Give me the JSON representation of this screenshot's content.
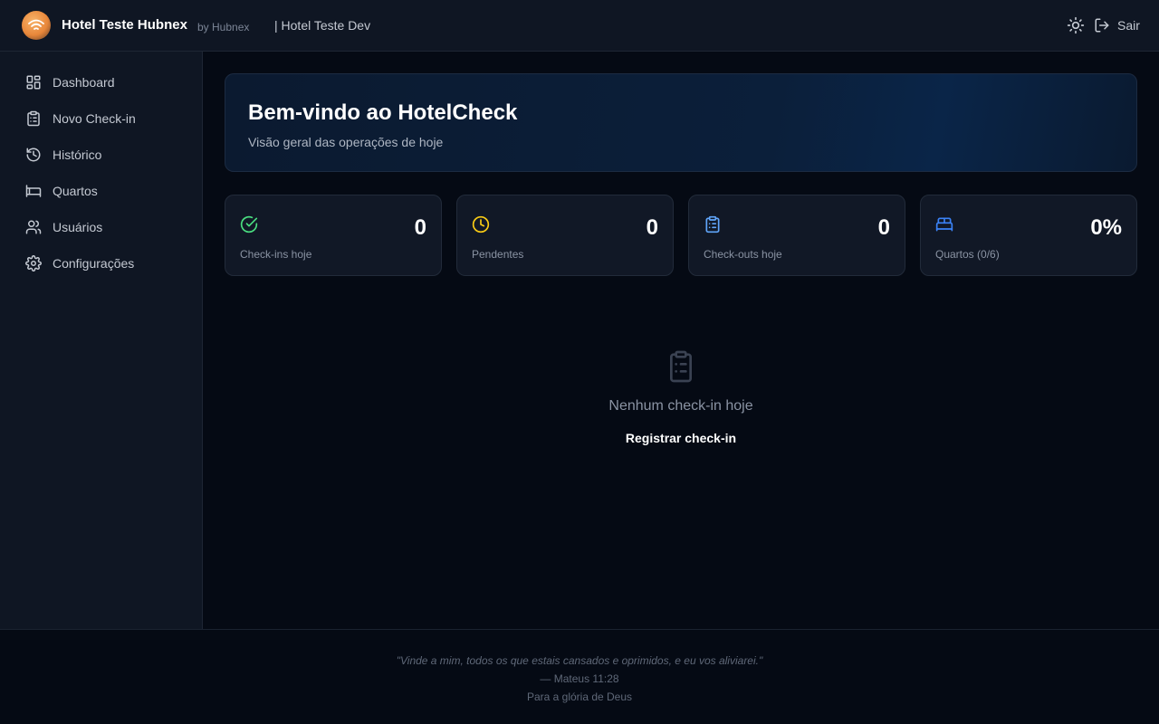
{
  "header": {
    "title": "Hotel Teste Hubnex",
    "by": "by Hubnex",
    "hotel": "| Hotel Teste Dev",
    "logout_label": "Sair",
    "theme_icon": "sun-icon",
    "logout_icon": "log-out-icon"
  },
  "sidebar": {
    "items": [
      {
        "label": "Dashboard",
        "icon": "layout-dashboard-icon"
      },
      {
        "label": "Novo Check-in",
        "icon": "clipboard-list-icon"
      },
      {
        "label": "Histórico",
        "icon": "history-icon"
      },
      {
        "label": "Quartos",
        "icon": "bed-icon"
      },
      {
        "label": "Usuários",
        "icon": "users-icon"
      },
      {
        "label": "Configurações",
        "icon": "settings-icon"
      }
    ]
  },
  "banner": {
    "title": "Bem-vindo ao HotelCheck",
    "subtitle": "Visão geral das operações de hoje"
  },
  "stats": [
    {
      "value": "0",
      "label": "Check-ins hoje",
      "icon": "check-circle-icon",
      "color": "#4ade80"
    },
    {
      "value": "0",
      "label": "Pendentes",
      "icon": "clock-icon",
      "color": "#facc15"
    },
    {
      "value": "0",
      "label": "Check-outs hoje",
      "icon": "clipboard-icon",
      "color": "#60a5fa"
    },
    {
      "value": "0%",
      "label": "Quartos (0/6)",
      "icon": "bed-icon",
      "color": "#3b82f6"
    }
  ],
  "empty_state": {
    "icon": "clipboard-list-icon",
    "text": "Nenhum check-in hoje",
    "action": "Registrar check-in"
  },
  "footer": {
    "quote": "\"Vinde a mim, todos os que estais cansados e oprimidos, e eu vos aliviarei.\"",
    "reference": "— Mateus 11:28",
    "dedication": "Para a glória de Deus"
  }
}
